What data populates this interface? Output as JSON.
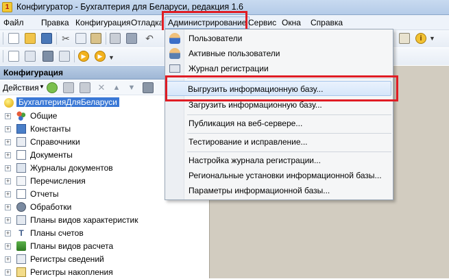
{
  "window": {
    "title": "Конфигуратор - Бухгалтерия для Беларуси, редакция 1.6"
  },
  "menu": {
    "items": [
      "Файл",
      "Правка",
      "Конфигурация",
      "Отладка",
      "Администрирование",
      "Сервис",
      "Окна",
      "Справка"
    ],
    "active": "Администрирование"
  },
  "panel": {
    "title": "Конфигурация",
    "actions_label": "Действия"
  },
  "tree": {
    "root": "БухгалтерияДляБеларуси",
    "items": [
      {
        "label": "Общие",
        "icon": "shapes-icon"
      },
      {
        "label": "Константы",
        "icon": "constants-icon"
      },
      {
        "label": "Справочники",
        "icon": "catalog-icon"
      },
      {
        "label": "Документы",
        "icon": "document-icon"
      },
      {
        "label": "Журналы документов",
        "icon": "journal-icon"
      },
      {
        "label": "Перечисления",
        "icon": "enum-icon"
      },
      {
        "label": "Отчеты",
        "icon": "report-icon"
      },
      {
        "label": "Обработки",
        "icon": "processing-icon"
      },
      {
        "label": "Планы видов характеристик",
        "icon": "chart-characteristics-icon"
      },
      {
        "label": "Планы счетов",
        "icon": "accounts-icon"
      },
      {
        "label": "Планы видов расчета",
        "icon": "calculation-icon"
      },
      {
        "label": "Регистры сведений",
        "icon": "info-register-icon"
      },
      {
        "label": "Регистры накопления",
        "icon": "accumulation-register-icon"
      }
    ]
  },
  "dropdown": {
    "items": [
      {
        "label": "Пользователи",
        "icon": "user-icon"
      },
      {
        "label": "Активные пользователи",
        "icon": "active-users-icon"
      },
      {
        "label": "Журнал регистрации",
        "icon": "event-log-icon"
      },
      {
        "label": "Выгрузить информационную базу...",
        "highlighted": true
      },
      {
        "label": "Загрузить информационную базу..."
      },
      {
        "label": "Публикация на веб-сервере..."
      },
      {
        "label": "Тестирование и исправление..."
      },
      {
        "label": "Настройка журнала регистрации..."
      },
      {
        "label": "Региональные установки информационной базы..."
      },
      {
        "label": "Параметры информационной базы..."
      }
    ]
  },
  "colors": {
    "annotation_red": "#e01c24",
    "selection_blue": "#3a78d6"
  }
}
